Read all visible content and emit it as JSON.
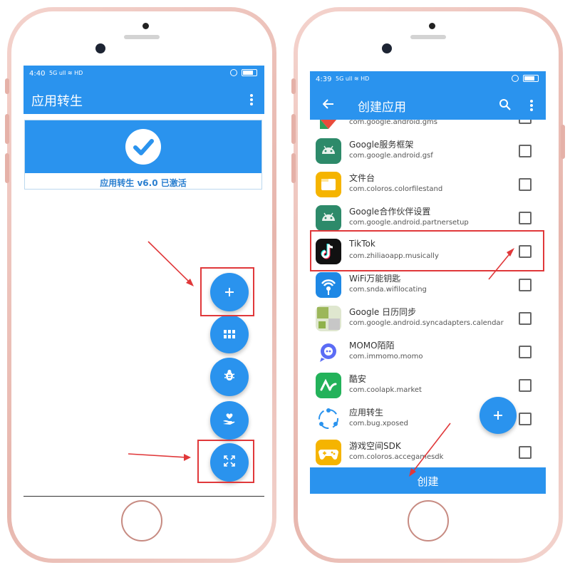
{
  "left_screen": {
    "status_time": "4:40",
    "status_icons": "5G ull ≋ HD",
    "title": "应用转生",
    "activated_text": "应用转生 v6.0 已激活",
    "fab_buttons": [
      {
        "name": "add",
        "icon": "plus-icon"
      },
      {
        "name": "apps",
        "icon": "grid-icon"
      },
      {
        "name": "bug",
        "icon": "bug-icon"
      },
      {
        "name": "donate",
        "icon": "heart-hand-icon"
      },
      {
        "name": "fullscreen",
        "icon": "fullscreen-icon"
      }
    ]
  },
  "right_screen": {
    "status_time": "4:39",
    "status_icons": "5G ull ≋ HD",
    "title": "创建应用",
    "partial_top_pkg": "com.google.android.gms",
    "apps": [
      {
        "name": "Google服务框架",
        "package": "com.google.android.gsf",
        "icon": "android-icon",
        "color": "#2d8a6a"
      },
      {
        "name": "文件台",
        "package": "com.coloros.colorfilestand",
        "icon": "folder-icon",
        "color": "#f5b400"
      },
      {
        "name": "Google合作伙伴设置",
        "package": "com.google.android.partnersetup",
        "icon": "android-icon",
        "color": "#2d8a6a"
      },
      {
        "name": "TikTok",
        "package": "com.zhiliaoapp.musically",
        "icon": "tiktok-icon",
        "color": "#111111"
      },
      {
        "name": "WiFi万能钥匙",
        "package": "com.snda.wifilocating",
        "icon": "wifi-key-icon",
        "color": "#1e88e5"
      },
      {
        "name": "Google 日历同步",
        "package": "com.google.android.syncadapters.calendar",
        "icon": "calendar-sync-icon",
        "color": "#9cb75a"
      },
      {
        "name": "MOMO陌陌",
        "package": "com.immomo.momo",
        "icon": "momo-icon",
        "color": "#5b6cf5"
      },
      {
        "name": "酷安",
        "package": "com.coolapk.market",
        "icon": "coolapk-icon",
        "color": "#23b25a"
      },
      {
        "name": "应用转生",
        "package": "com.bug.xposed",
        "icon": "share-nodes-icon",
        "color": "#2a93ee"
      },
      {
        "name": "游戏空间SDK",
        "package": "com.coloros.accegamesdk",
        "icon": "gamepad-icon",
        "color": "#f5b400"
      }
    ],
    "create_button": "创建"
  },
  "colors": {
    "primary": "#2a93ee",
    "annotation": "#e0383a",
    "phone_frame": "#e7b6ad"
  }
}
